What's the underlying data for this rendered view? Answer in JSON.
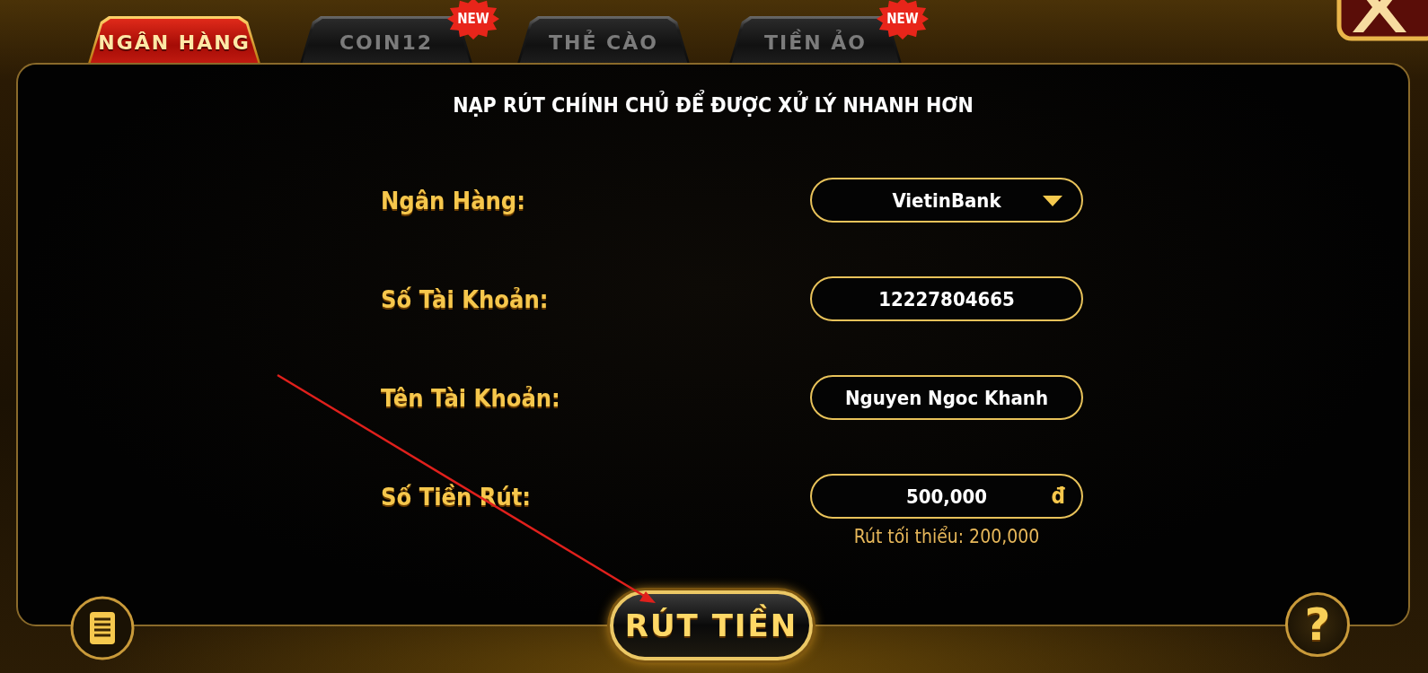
{
  "tabs": [
    {
      "label": "NGÂN HÀNG",
      "selected": true
    },
    {
      "label": "COIN12",
      "selected": false,
      "badge": "NEW"
    },
    {
      "label": "THẺ CÀO",
      "selected": false
    },
    {
      "label": "TIỀN ẢO",
      "selected": false,
      "badge": "NEW"
    }
  ],
  "notice": "NẠP RÚT CHÍNH CHỦ ĐỂ ĐƯỢC XỬ LÝ NHANH HƠN",
  "fields": [
    {
      "kind": "dropdown",
      "label": "Ngân Hàng:",
      "value": "VietinBank"
    },
    {
      "kind": "text",
      "label": "Số Tài Khoản:",
      "value": "12227804665"
    },
    {
      "kind": "text",
      "label": "Tên Tài Khoản:",
      "value": "Nguyen Ngoc Khanh"
    },
    {
      "kind": "amount",
      "label": "Số Tiền Rút:",
      "value": "500,000",
      "unit": "đ",
      "hint": "Rút tối thiểu: 200,000"
    }
  ],
  "submit_button": "RÚT TIỀN",
  "help_button": "?",
  "annotation_arrow": true
}
